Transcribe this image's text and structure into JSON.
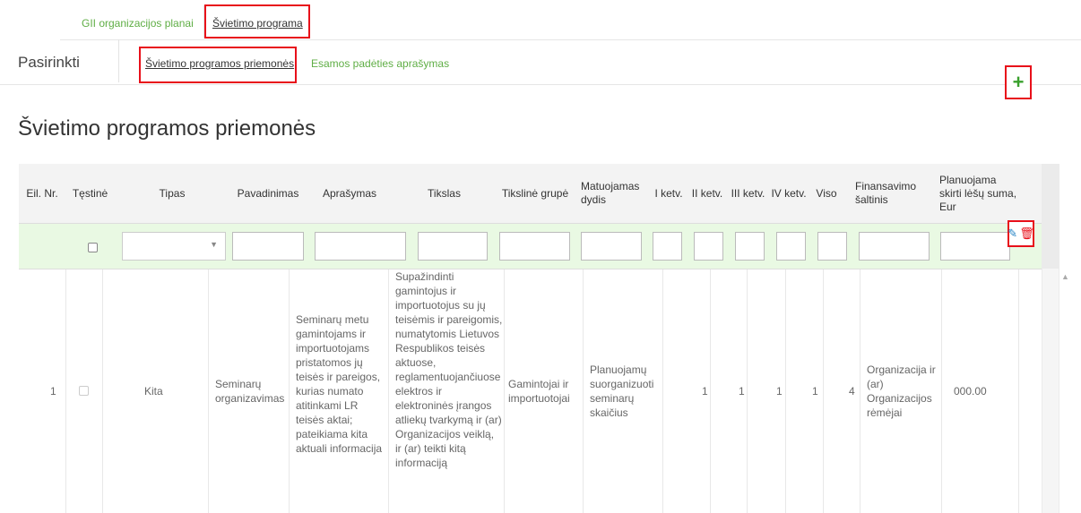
{
  "top_tabs": {
    "tab1": "GII organizacijos planai",
    "tab2": "Švietimo programa"
  },
  "second_row": {
    "label": "Pasirinkti",
    "tab1": "Švietimo programos priemonės",
    "tab2": "Esamos padėties aprašymas"
  },
  "page_title": "Švietimo programos priemonės",
  "table": {
    "headers": {
      "eil_nr": "Eil. Nr.",
      "testine": "Tęstinė",
      "tipas": "Tipas",
      "pavadinimas": "Pavadinimas",
      "aprasymas": "Aprašymas",
      "tikslas": "Tikslas",
      "tiksline": "Tikslinė grupė",
      "matuojamas": "Matuojamas dydis",
      "q1": "I ketv.",
      "q2": "II ketv.",
      "q3": "III ketv.",
      "q4": "IV ketv.",
      "viso": "Viso",
      "finansavimo": "Finansavimo šaltinis",
      "planuojama": "Planuojama skirti lėšų suma, Eur"
    },
    "row": {
      "nr": "1",
      "tipas": "Kita",
      "pavadinimas": "Seminarų organizavimas",
      "aprasymas": "Seminarų metu gamintojams ir importuotojams pristatomos jų teisės ir pareigos, kurias numato atitinkami LR teisės aktai; pateikiama kita aktuali informacija",
      "tikslas": "Supažindinti gamintojus ir importuotojus su jų teisėmis ir pareigomis, numatytomis Lietuvos Respublikos teisės aktuose, reglamentuojančiuose elektros ir elektroninės įrangos atliekų tvarkymą ir (ar) Organizacijos veiklą, ir (ar) teikti kitą informaciją",
      "tiksline": "Gamintojai ir importuotojai",
      "matuojamas": "Planuojamų suorganizuoti seminarų skaičius",
      "q1": "1",
      "q2": "1",
      "q3": "1",
      "q4": "1",
      "viso": "4",
      "finansavimo": "Organizacija ir (ar) Organizacijos rėmėjai",
      "suma": "000.00"
    }
  },
  "icons": {
    "add": "plus-icon",
    "edit": "pencil-icon",
    "delete": "trash-icon"
  },
  "colors": {
    "accent_green": "#5fae45",
    "highlight_red": "#e8101a",
    "filter_row_bg": "#e9f9e3"
  }
}
